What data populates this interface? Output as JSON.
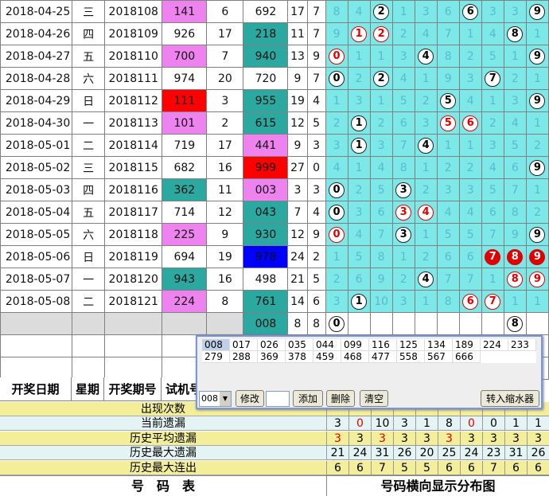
{
  "rows": [
    {
      "date": "2018-04-25",
      "wk": "三",
      "issue": "2018108",
      "tr": "141",
      "trc": "tr-pink",
      "ts": "6",
      "sm": "692",
      "smc": "",
      "s": "17",
      "k": "7",
      "d": [
        [
          "8",
          ""
        ],
        [
          "4",
          ""
        ],
        [
          "2",
          "b"
        ],
        [
          "1",
          ""
        ],
        [
          "3",
          ""
        ],
        [
          "6",
          ""
        ],
        [
          "6",
          "b"
        ],
        [
          "3",
          ""
        ],
        [
          "3",
          ""
        ],
        [
          "9",
          "b"
        ]
      ]
    },
    {
      "date": "2018-04-26",
      "wk": "四",
      "issue": "2018109",
      "tr": "926",
      "trc": "",
      "ts": "17",
      "sm": "218",
      "smc": "sm-teal",
      "s": "11",
      "k": "7",
      "d": [
        [
          "9",
          ""
        ],
        [
          "1",
          "r"
        ],
        [
          "2",
          "r"
        ],
        [
          "2",
          ""
        ],
        [
          "4",
          ""
        ],
        [
          "7",
          ""
        ],
        [
          "1",
          ""
        ],
        [
          "4",
          ""
        ],
        [
          "8",
          "b"
        ],
        [
          "1",
          ""
        ]
      ]
    },
    {
      "date": "2018-04-27",
      "wk": "五",
      "issue": "2018110",
      "tr": "700",
      "trc": "tr-pink",
      "ts": "7",
      "sm": "940",
      "smc": "sm-teal",
      "s": "13",
      "k": "9",
      "d": [
        [
          "0",
          "r"
        ],
        [
          "1",
          ""
        ],
        [
          "1",
          ""
        ],
        [
          "3",
          ""
        ],
        [
          "4",
          "b"
        ],
        [
          "8",
          ""
        ],
        [
          "2",
          ""
        ],
        [
          "5",
          ""
        ],
        [
          "1",
          ""
        ],
        [
          "9",
          "b"
        ]
      ]
    },
    {
      "date": "2018-04-28",
      "wk": "六",
      "issue": "2018111",
      "tr": "974",
      "trc": "",
      "ts": "20",
      "sm": "720",
      "smc": "",
      "s": "9",
      "k": "7",
      "d": [
        [
          "0",
          "b"
        ],
        [
          "2",
          ""
        ],
        [
          "2",
          "b"
        ],
        [
          "4",
          ""
        ],
        [
          "1",
          ""
        ],
        [
          "9",
          ""
        ],
        [
          "3",
          ""
        ],
        [
          "7",
          "b"
        ],
        [
          "2",
          ""
        ],
        [
          "1",
          ""
        ]
      ]
    },
    {
      "date": "2018-04-29",
      "wk": "日",
      "issue": "2018112",
      "tr": "111",
      "trc": "tr-red",
      "ts": "3",
      "sm": "955",
      "smc": "sm-teal",
      "s": "19",
      "k": "4",
      "d": [
        [
          "1",
          ""
        ],
        [
          "3",
          ""
        ],
        [
          "1",
          ""
        ],
        [
          "5",
          ""
        ],
        [
          "2",
          ""
        ],
        [
          "5",
          "b"
        ],
        [
          "4",
          ""
        ],
        [
          "1",
          ""
        ],
        [
          "3",
          ""
        ],
        [
          "9",
          "b"
        ]
      ]
    },
    {
      "date": "2018-04-30",
      "wk": "一",
      "issue": "2018113",
      "tr": "101",
      "trc": "tr-pink",
      "ts": "2",
      "sm": "615",
      "smc": "sm-teal",
      "s": "12",
      "k": "5",
      "d": [
        [
          "2",
          ""
        ],
        [
          "1",
          "b"
        ],
        [
          "2",
          ""
        ],
        [
          "6",
          ""
        ],
        [
          "3",
          ""
        ],
        [
          "5",
          "r"
        ],
        [
          "6",
          "r"
        ],
        [
          "2",
          ""
        ],
        [
          "4",
          ""
        ],
        [
          "1",
          ""
        ]
      ]
    },
    {
      "date": "2018-05-01",
      "wk": "二",
      "issue": "2018114",
      "tr": "719",
      "trc": "",
      "ts": "17",
      "sm": "441",
      "smc": "tr-pink",
      "s": "9",
      "k": "3",
      "d": [
        [
          "3",
          ""
        ],
        [
          "1",
          "b"
        ],
        [
          "3",
          ""
        ],
        [
          "7",
          ""
        ],
        [
          "4",
          "b"
        ],
        [
          "1",
          ""
        ],
        [
          "1",
          ""
        ],
        [
          "3",
          ""
        ],
        [
          "5",
          ""
        ],
        [
          "2",
          ""
        ]
      ]
    },
    {
      "date": "2018-05-02",
      "wk": "三",
      "issue": "2018115",
      "tr": "682",
      "trc": "",
      "ts": "16",
      "sm": "999",
      "smc": "sm-red",
      "s": "27",
      "k": "0",
      "d": [
        [
          "4",
          ""
        ],
        [
          "1",
          ""
        ],
        [
          "4",
          ""
        ],
        [
          "8",
          ""
        ],
        [
          "1",
          ""
        ],
        [
          "2",
          ""
        ],
        [
          "2",
          ""
        ],
        [
          "4",
          ""
        ],
        [
          "6",
          ""
        ],
        [
          "9",
          "b"
        ]
      ]
    },
    {
      "date": "2018-05-03",
      "wk": "四",
      "issue": "2018116",
      "tr": "362",
      "trc": "sm-teal",
      "ts": "11",
      "sm": "003",
      "smc": "tr-pink",
      "s": "3",
      "k": "3",
      "d": [
        [
          "0",
          "b"
        ],
        [
          "2",
          ""
        ],
        [
          "5",
          ""
        ],
        [
          "3",
          "b"
        ],
        [
          "2",
          ""
        ],
        [
          "3",
          ""
        ],
        [
          "3",
          ""
        ],
        [
          "5",
          ""
        ],
        [
          "7",
          ""
        ],
        [
          "1",
          ""
        ]
      ]
    },
    {
      "date": "2018-05-04",
      "wk": "五",
      "issue": "2018117",
      "tr": "714",
      "trc": "",
      "ts": "12",
      "sm": "043",
      "smc": "sm-teal",
      "s": "7",
      "k": "4",
      "d": [
        [
          "0",
          "b"
        ],
        [
          "3",
          ""
        ],
        [
          "6",
          ""
        ],
        [
          "3",
          "r"
        ],
        [
          "4",
          "r"
        ],
        [
          "4",
          ""
        ],
        [
          "4",
          ""
        ],
        [
          "6",
          ""
        ],
        [
          "8",
          ""
        ],
        [
          "2",
          ""
        ]
      ]
    },
    {
      "date": "2018-05-05",
      "wk": "六",
      "issue": "2018118",
      "tr": "225",
      "trc": "tr-pink",
      "ts": "9",
      "sm": "930",
      "smc": "sm-teal",
      "s": "12",
      "k": "9",
      "d": [
        [
          "0",
          "r"
        ],
        [
          "4",
          ""
        ],
        [
          "7",
          ""
        ],
        [
          "3",
          "b"
        ],
        [
          "1",
          ""
        ],
        [
          "5",
          ""
        ],
        [
          "5",
          ""
        ],
        [
          "7",
          ""
        ],
        [
          "9",
          ""
        ],
        [
          "9",
          "b"
        ]
      ]
    },
    {
      "date": "2018-05-06",
      "wk": "日",
      "issue": "2018119",
      "tr": "694",
      "trc": "",
      "ts": "19",
      "sm": "978",
      "smc": "sm-blue",
      "s": "24",
      "k": "2",
      "d": [
        [
          "1",
          ""
        ],
        [
          "5",
          ""
        ],
        [
          "8",
          ""
        ],
        [
          "1",
          ""
        ],
        [
          "2",
          ""
        ],
        [
          "6",
          ""
        ],
        [
          "6",
          ""
        ],
        [
          "7",
          "f"
        ],
        [
          "8",
          "f"
        ],
        [
          "9",
          "f"
        ]
      ]
    },
    {
      "date": "2018-05-07",
      "wk": "一",
      "issue": "2018120",
      "tr": "943",
      "trc": "sm-teal",
      "ts": "16",
      "sm": "498",
      "smc": "",
      "s": "21",
      "k": "5",
      "d": [
        [
          "2",
          ""
        ],
        [
          "6",
          ""
        ],
        [
          "9",
          ""
        ],
        [
          "2",
          ""
        ],
        [
          "4",
          "b"
        ],
        [
          "7",
          ""
        ],
        [
          "7",
          ""
        ],
        [
          "1",
          ""
        ],
        [
          "8",
          "r"
        ],
        [
          "9",
          "r"
        ]
      ]
    },
    {
      "date": "2018-05-08",
      "wk": "二",
      "issue": "2018121",
      "tr": "224",
      "trc": "tr-pink",
      "ts": "8",
      "sm": "761",
      "smc": "sm-teal",
      "s": "14",
      "k": "6",
      "d": [
        [
          "3",
          ""
        ],
        [
          "1",
          "b"
        ],
        [
          "10",
          ""
        ],
        [
          "3",
          ""
        ],
        [
          "1",
          ""
        ],
        [
          "8",
          ""
        ],
        [
          "6",
          "r"
        ],
        [
          "7",
          "r"
        ],
        [
          "1",
          ""
        ],
        [
          "1",
          ""
        ]
      ]
    }
  ],
  "prediction": {
    "sm": "008",
    "s": "8",
    "k": "8",
    "d0": "0",
    "d8": "8"
  },
  "headers": [
    "开奖日期",
    "星期",
    "开奖期号",
    "试机号"
  ],
  "popup": {
    "nums": [
      "008",
      "017",
      "026",
      "035",
      "044",
      "099",
      "116",
      "125",
      "134",
      "189",
      "224",
      "233",
      "279",
      "288",
      "369",
      "378",
      "459",
      "468",
      "477",
      "558",
      "567",
      "666"
    ],
    "combo": "008",
    "modify": "修改",
    "add": "添加",
    "delete": "删除",
    "clear": "清空",
    "water": "转入缩水器"
  },
  "stats": [
    {
      "label": "出现次数",
      "vals": [
        "",
        "",
        "",
        "",
        "",
        "",
        "",
        "",
        "",
        ""
      ],
      "color": "#f2ee9a"
    },
    {
      "label": "当前遗漏",
      "vals": [
        "3",
        "0",
        "10",
        "3",
        "1",
        "8",
        "0",
        "0",
        "1",
        "1"
      ],
      "red": [
        1,
        6
      ],
      "color": "#e4f4f4"
    },
    {
      "label": "历史平均遗漏",
      "vals": [
        "3",
        "3",
        "3",
        "3",
        "3",
        "3",
        "3",
        "3",
        "3",
        "3"
      ],
      "red": [
        0,
        2,
        5
      ],
      "color": "#f2ee9a"
    },
    {
      "label": "历史最大遗漏",
      "vals": [
        "21",
        "24",
        "31",
        "26",
        "20",
        "25",
        "24",
        "23",
        "31",
        "26"
      ],
      "red": [],
      "color": "#e4f4f4"
    },
    {
      "label": "历史最大连出",
      "vals": [
        "6",
        "6",
        "7",
        "5",
        "5",
        "6",
        "6",
        "7",
        "6",
        "6"
      ],
      "red": [],
      "color": "#f2ee9a"
    }
  ],
  "footer": {
    "left": "号　码　表",
    "right": "号码横向显示分布图"
  }
}
